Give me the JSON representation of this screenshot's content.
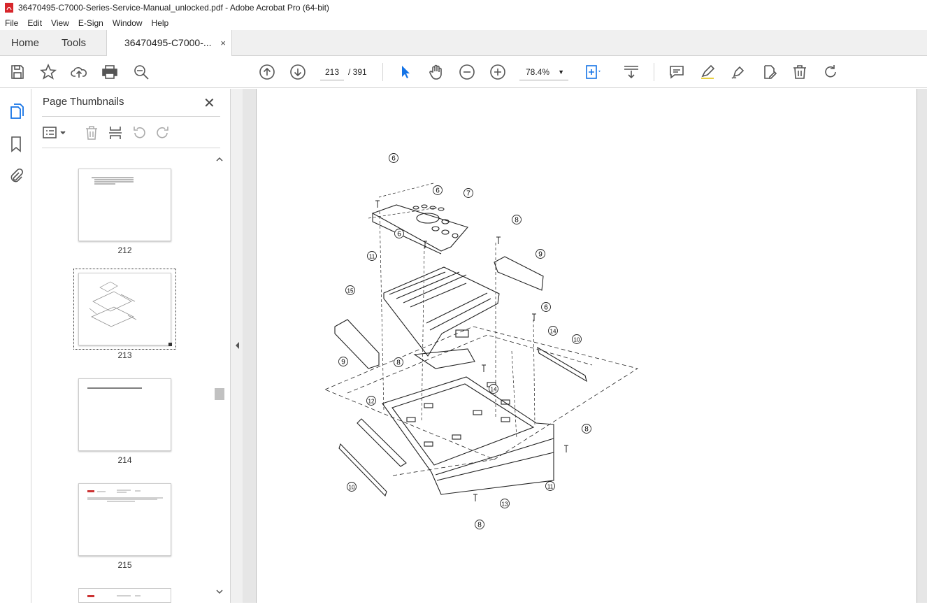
{
  "window": {
    "title": "36470495-C7000-Series-Service-Manual_unlocked.pdf - Adobe Acrobat Pro (64-bit)"
  },
  "menu": [
    "File",
    "Edit",
    "View",
    "E-Sign",
    "Window",
    "Help"
  ],
  "tabs": {
    "home": "Home",
    "tools": "Tools",
    "document": "36470495-C7000-...",
    "close": "×"
  },
  "toolbar": {
    "current_page": "213",
    "total_pages": "/ 391",
    "zoom": "78.4%"
  },
  "panel": {
    "title": "Page Thumbnails",
    "close": "✕"
  },
  "thumbnails": [
    {
      "label": "212"
    },
    {
      "label": "213",
      "selected": true
    },
    {
      "label": "214"
    },
    {
      "label": "215"
    }
  ],
  "diagram": {
    "callouts": [
      "6",
      "6",
      "7",
      "6",
      "8",
      "11",
      "9",
      "15",
      "6",
      "14",
      "9",
      "8",
      "10",
      "14",
      "12",
      "8",
      "11",
      "13",
      "10",
      "8"
    ]
  },
  "colors": {
    "accent": "#1473e6",
    "chrome": "#f0f0f0",
    "doc_bg": "#e6e6e6"
  }
}
